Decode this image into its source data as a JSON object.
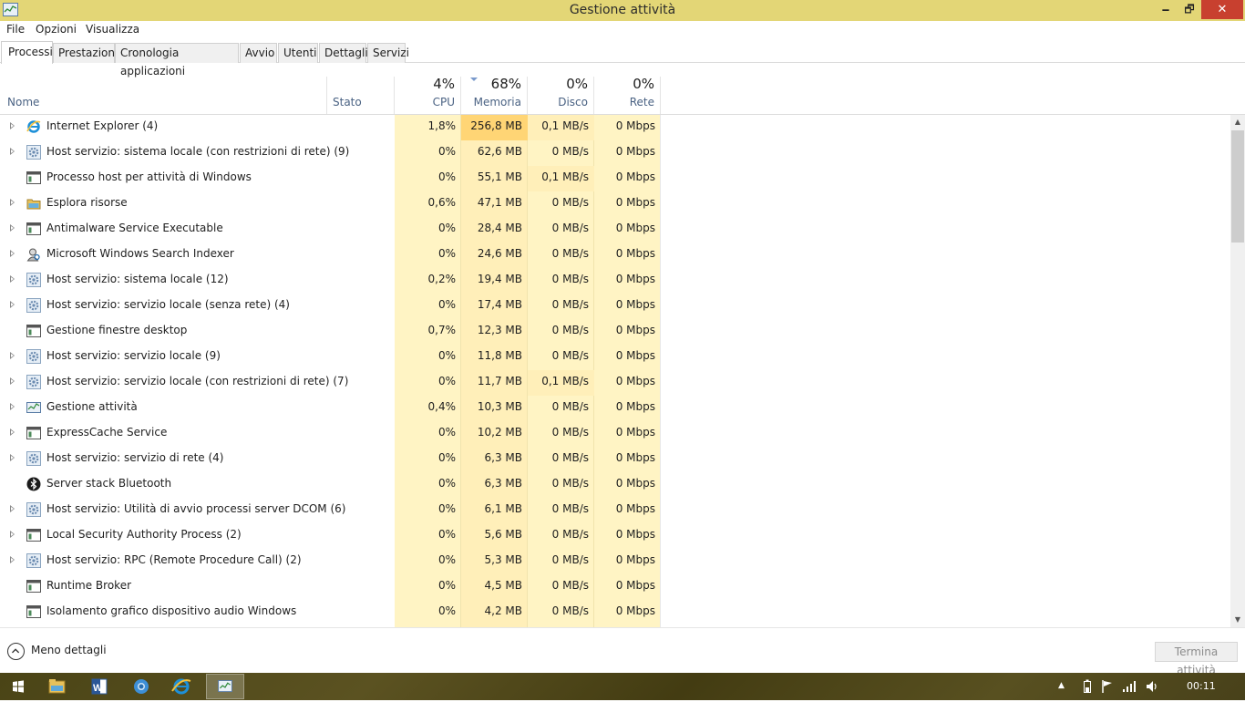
{
  "window": {
    "title": "Gestione attività",
    "minimize": "🗕",
    "maximize": "🗗",
    "close": "✕"
  },
  "menu": [
    "File",
    "Opzioni",
    "Visualizza"
  ],
  "tabs": [
    "Processi",
    "Prestazioni",
    "Cronologia applicazioni",
    "Avvio",
    "Utenti",
    "Dettagli",
    "Servizi"
  ],
  "active_tab": "Processi",
  "columns": {
    "name": "Nome",
    "status": "Stato",
    "cpu": {
      "pct": "4%",
      "label": "CPU"
    },
    "memory": {
      "pct": "68%",
      "label": "Memoria"
    },
    "disk": {
      "pct": "0%",
      "label": "Disco"
    },
    "network": {
      "pct": "0%",
      "label": "Rete"
    }
  },
  "sorted_column": "memory",
  "processes": [
    {
      "name": "Internet Explorer (4)",
      "icon": "ie-icon",
      "expandable": true,
      "cpu": "1,8%",
      "mem": "256,8 MB",
      "disk": "0,1 MB/s",
      "net": "0 Mbps"
    },
    {
      "name": "Host servizio: sistema locale (con restrizioni di rete) (9)",
      "icon": "gear-icon",
      "expandable": true,
      "cpu": "0%",
      "mem": "62,6 MB",
      "disk": "0 MB/s",
      "net": "0 Mbps"
    },
    {
      "name": "Processo host per attività di Windows",
      "icon": "window-icon",
      "expandable": false,
      "cpu": "0%",
      "mem": "55,1 MB",
      "disk": "0,1 MB/s",
      "net": "0 Mbps"
    },
    {
      "name": "Esplora risorse",
      "icon": "folder-icon",
      "expandable": true,
      "cpu": "0,6%",
      "mem": "47,1 MB",
      "disk": "0 MB/s",
      "net": "0 Mbps"
    },
    {
      "name": "Antimalware Service Executable",
      "icon": "window-icon",
      "expandable": true,
      "cpu": "0%",
      "mem": "28,4 MB",
      "disk": "0 MB/s",
      "net": "0 Mbps"
    },
    {
      "name": "Microsoft Windows Search Indexer",
      "icon": "search-indexer-icon",
      "expandable": true,
      "cpu": "0%",
      "mem": "24,6 MB",
      "disk": "0 MB/s",
      "net": "0 Mbps"
    },
    {
      "name": "Host servizio: sistema locale (12)",
      "icon": "gear-icon",
      "expandable": true,
      "cpu": "0,2%",
      "mem": "19,4 MB",
      "disk": "0 MB/s",
      "net": "0 Mbps"
    },
    {
      "name": "Host servizio: servizio locale (senza rete) (4)",
      "icon": "gear-icon",
      "expandable": true,
      "cpu": "0%",
      "mem": "17,4 MB",
      "disk": "0 MB/s",
      "net": "0 Mbps"
    },
    {
      "name": "Gestione finestre desktop",
      "icon": "window-icon",
      "expandable": false,
      "cpu": "0,7%",
      "mem": "12,3 MB",
      "disk": "0 MB/s",
      "net": "0 Mbps"
    },
    {
      "name": "Host servizio: servizio locale (9)",
      "icon": "gear-icon",
      "expandable": true,
      "cpu": "0%",
      "mem": "11,8 MB",
      "disk": "0 MB/s",
      "net": "0 Mbps"
    },
    {
      "name": "Host servizio: servizio locale (con restrizioni di rete) (7)",
      "icon": "gear-icon",
      "expandable": true,
      "cpu": "0%",
      "mem": "11,7 MB",
      "disk": "0,1 MB/s",
      "net": "0 Mbps"
    },
    {
      "name": "Gestione attività",
      "icon": "task-manager-icon",
      "expandable": true,
      "cpu": "0,4%",
      "mem": "10,3 MB",
      "disk": "0 MB/s",
      "net": "0 Mbps"
    },
    {
      "name": "ExpressCache Service",
      "icon": "window-icon",
      "expandable": true,
      "cpu": "0%",
      "mem": "10,2 MB",
      "disk": "0 MB/s",
      "net": "0 Mbps"
    },
    {
      "name": "Host servizio: servizio di rete (4)",
      "icon": "gear-icon",
      "expandable": true,
      "cpu": "0%",
      "mem": "6,3 MB",
      "disk": "0 MB/s",
      "net": "0 Mbps"
    },
    {
      "name": "Server stack Bluetooth",
      "icon": "bluetooth-icon",
      "expandable": false,
      "cpu": "0%",
      "mem": "6,3 MB",
      "disk": "0 MB/s",
      "net": "0 Mbps"
    },
    {
      "name": "Host servizio: Utilità di avvio processi server DCOM (6)",
      "icon": "gear-icon",
      "expandable": true,
      "cpu": "0%",
      "mem": "6,1 MB",
      "disk": "0 MB/s",
      "net": "0 Mbps"
    },
    {
      "name": "Local Security Authority Process (2)",
      "icon": "window-icon",
      "expandable": true,
      "cpu": "0%",
      "mem": "5,6 MB",
      "disk": "0 MB/s",
      "net": "0 Mbps"
    },
    {
      "name": "Host servizio: RPC (Remote Procedure Call) (2)",
      "icon": "gear-icon",
      "expandable": true,
      "cpu": "0%",
      "mem": "5,3 MB",
      "disk": "0 MB/s",
      "net": "0 Mbps"
    },
    {
      "name": "Runtime Broker",
      "icon": "window-icon",
      "expandable": false,
      "cpu": "0%",
      "mem": "4,5 MB",
      "disk": "0 MB/s",
      "net": "0 Mbps"
    },
    {
      "name": "Isolamento grafico dispositivo audio Windows",
      "icon": "window-icon",
      "expandable": false,
      "cpu": "0%",
      "mem": "4,2 MB",
      "disk": "0 MB/s",
      "net": "0 Mbps"
    }
  ],
  "footer": {
    "less_details": "Meno dettagli",
    "end_task": "Termina attività"
  },
  "taskbar": {
    "start_icon": "windows-start-icon",
    "apps": [
      "file-explorer-icon",
      "word-icon",
      "chrome-icon",
      "internet-explorer-icon",
      "task-manager-icon"
    ],
    "active_app": "task-manager-icon",
    "clock": "00:11"
  },
  "colors": {
    "titlebar": "#e3d676",
    "close_red": "#c8402f",
    "heat_light": "#fff4c4",
    "heat_mem": "#ffefb9",
    "heat_high": "#ffd575",
    "header_label": "#4a6283"
  }
}
